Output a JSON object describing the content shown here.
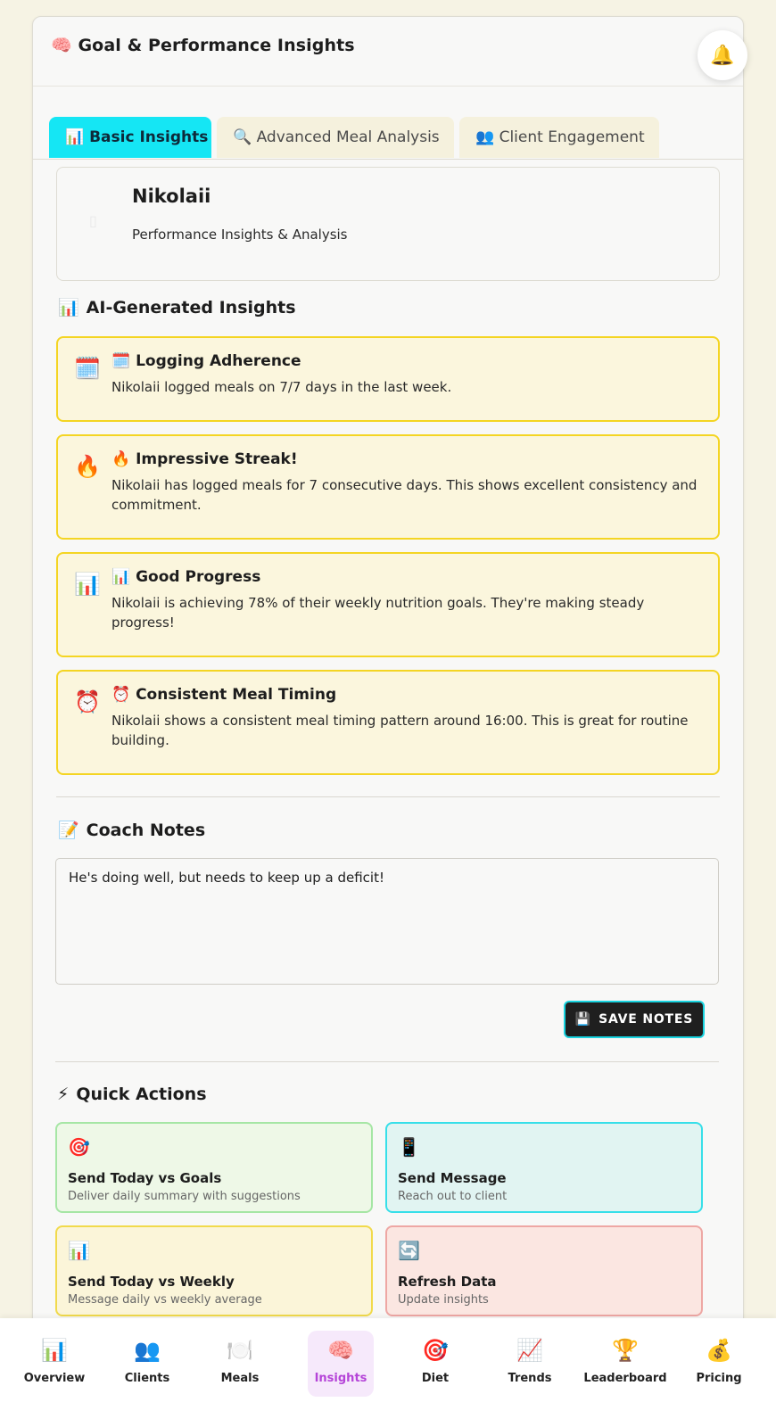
{
  "header": {
    "title": "🧠 Goal & Performance Insights",
    "bell_icon": "🔔"
  },
  "tabs": [
    {
      "label": "📊 Basic Insights",
      "active": true
    },
    {
      "label": "🔍 Advanced Meal Analysis",
      "active": false
    },
    {
      "label": "👥 Client Engagement",
      "active": false
    }
  ],
  "profile": {
    "name": "Nikolaii",
    "subtitle": "Performance Insights & Analysis"
  },
  "ai_insights": {
    "title": "AI-Generated Insights",
    "icon": "📊",
    "items": [
      {
        "icon": "🗓️",
        "title": "🗓️ Logging Adherence",
        "text": "Nikolaii logged meals on 7/7 days in the last week."
      },
      {
        "icon": "🔥",
        "title": "🔥 Impressive Streak!",
        "text": "Nikolaii has logged meals for 7 consecutive days. This shows excellent consistency and commitment."
      },
      {
        "icon": "📊",
        "title": "📊 Good Progress",
        "text": "Nikolaii is achieving 78% of their weekly nutrition goals. They're making steady progress!"
      },
      {
        "icon": "⏰",
        "title": "⏰ Consistent Meal Timing",
        "text": "Nikolaii shows a consistent meal timing pattern around 16:00. This is great for routine building."
      }
    ]
  },
  "coach_notes": {
    "title": "Coach Notes",
    "icon": "📝",
    "value": "He's doing well, but needs to keep up a deficit!",
    "save_icon": "💾",
    "save_label": "SAVE NOTES"
  },
  "quick_actions": {
    "title": "Quick Actions",
    "icon": "⚡",
    "items": [
      {
        "icon": "🎯",
        "title": "Send Today vs Goals",
        "sub": "Deliver daily summary with suggestions"
      },
      {
        "icon": "📱",
        "title": "Send Message",
        "sub": "Reach out to client"
      },
      {
        "icon": "📊",
        "title": "Send Today vs Weekly",
        "sub": "Message daily vs weekly average"
      },
      {
        "icon": "🔄",
        "title": "Refresh Data",
        "sub": "Update insights"
      }
    ]
  },
  "nav": [
    {
      "icon": "📊",
      "label": "Overview"
    },
    {
      "icon": "👥",
      "label": "Clients"
    },
    {
      "icon": "🍽️",
      "label": "Meals"
    },
    {
      "icon": "🧠",
      "label": "Insights",
      "active": true
    },
    {
      "icon": "🎯",
      "label": "Diet"
    },
    {
      "icon": "📈",
      "label": "Trends"
    },
    {
      "icon": "🏆",
      "label": "Leaderboard"
    },
    {
      "icon": "💰",
      "label": "Pricing"
    }
  ]
}
